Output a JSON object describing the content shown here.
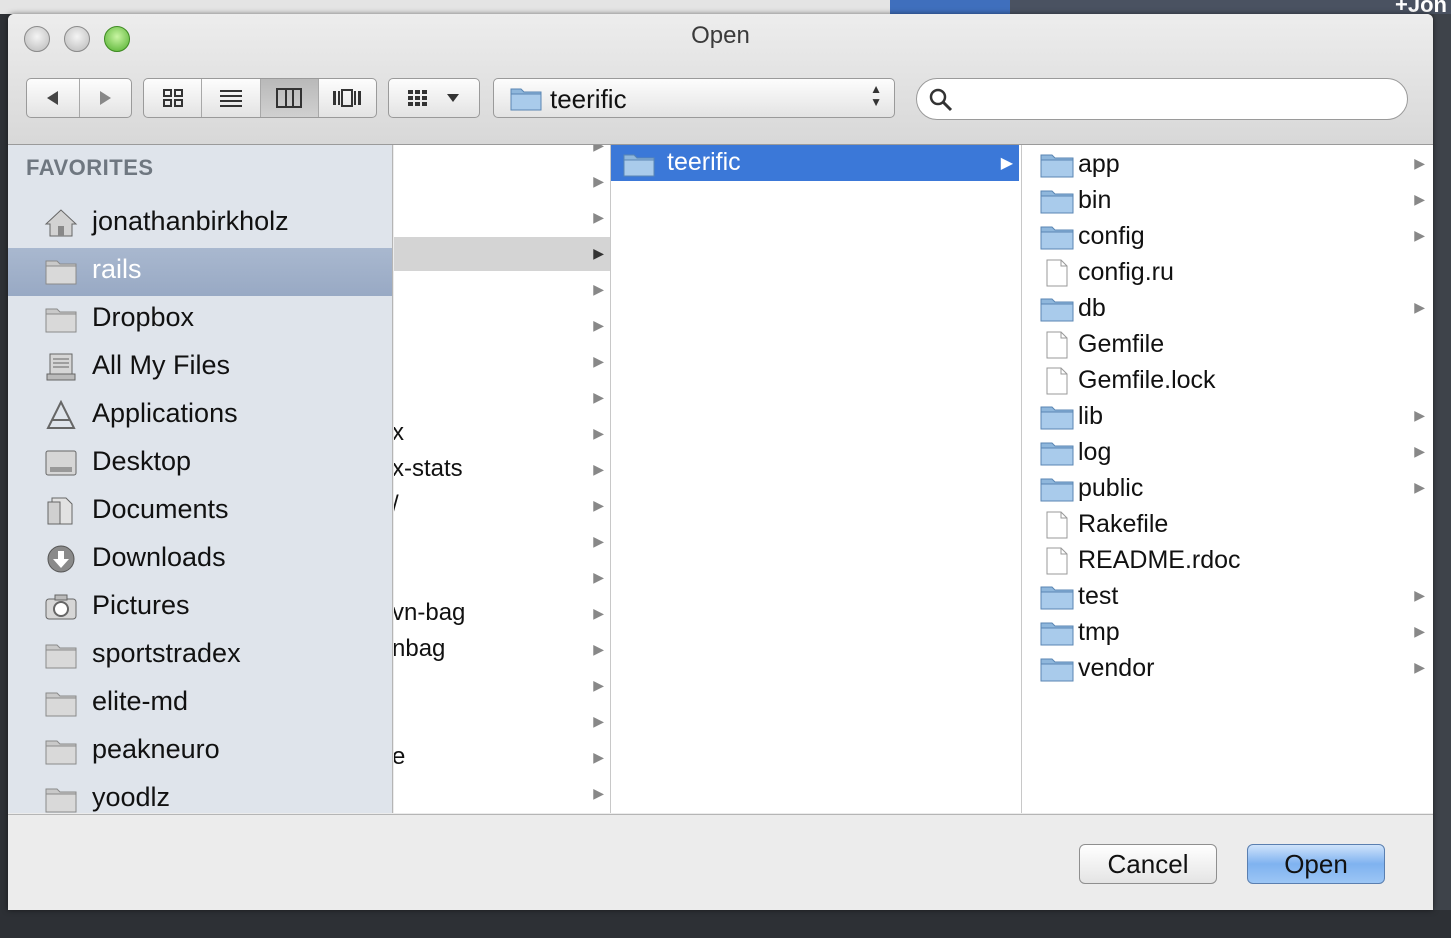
{
  "background": {
    "corner_text": "+Jon"
  },
  "dialog": {
    "title": "Open",
    "toolbar": {
      "back_icon": "triangle-left-icon",
      "forward_icon": "triangle-right-icon",
      "view_modes": [
        "icon-view",
        "list-view",
        "column-view",
        "coverflow-view"
      ],
      "active_view": "column-view",
      "arrange_icon": "grid-icon",
      "location": "teerific",
      "search": {
        "value": "",
        "placeholder": ""
      }
    },
    "sidebar": {
      "heading": "FAVORITES",
      "items": [
        {
          "label": "jonathanbirkholz",
          "icon": "home-icon"
        },
        {
          "label": "rails",
          "icon": "folder-icon",
          "selected": true
        },
        {
          "label": "Dropbox",
          "icon": "folder-icon"
        },
        {
          "label": "All My Files",
          "icon": "files-icon"
        },
        {
          "label": "Applications",
          "icon": "applications-icon"
        },
        {
          "label": "Desktop",
          "icon": "desktop-icon"
        },
        {
          "label": "Documents",
          "icon": "documents-icon"
        },
        {
          "label": "Downloads",
          "icon": "downloads-icon"
        },
        {
          "label": "Pictures",
          "icon": "camera-icon"
        },
        {
          "label": "sportstradex",
          "icon": "folder-icon"
        },
        {
          "label": "elite-md",
          "icon": "folder-icon"
        },
        {
          "label": "peakneuro",
          "icon": "folder-icon"
        },
        {
          "label": "yoodlz",
          "icon": "folder-icon"
        }
      ]
    },
    "column1": {
      "rows": [
        "",
        "",
        "",
        "",
        "",
        "",
        "",
        "",
        "x",
        "x-stats",
        "/",
        "",
        "",
        "vn-bag",
        "nbag",
        "",
        "",
        "e",
        ""
      ],
      "highlighted_index": 3
    },
    "column2": {
      "selected": "teerific"
    },
    "column3": {
      "items": [
        {
          "name": "app",
          "type": "folder"
        },
        {
          "name": "bin",
          "type": "folder"
        },
        {
          "name": "config",
          "type": "folder"
        },
        {
          "name": "config.ru",
          "type": "file"
        },
        {
          "name": "db",
          "type": "folder"
        },
        {
          "name": "Gemfile",
          "type": "file"
        },
        {
          "name": "Gemfile.lock",
          "type": "file"
        },
        {
          "name": "lib",
          "type": "folder"
        },
        {
          "name": "log",
          "type": "folder"
        },
        {
          "name": "public",
          "type": "folder"
        },
        {
          "name": "Rakefile",
          "type": "file"
        },
        {
          "name": "README.rdoc",
          "type": "file"
        },
        {
          "name": "test",
          "type": "folder"
        },
        {
          "name": "tmp",
          "type": "folder"
        },
        {
          "name": "vendor",
          "type": "folder"
        }
      ]
    },
    "buttons": {
      "cancel": "Cancel",
      "open": "Open"
    }
  },
  "colors": {
    "selection": "#3b78d8",
    "sidebar_selected": "#a3b3cb",
    "sidebar_bg": "#dfe4eb"
  }
}
